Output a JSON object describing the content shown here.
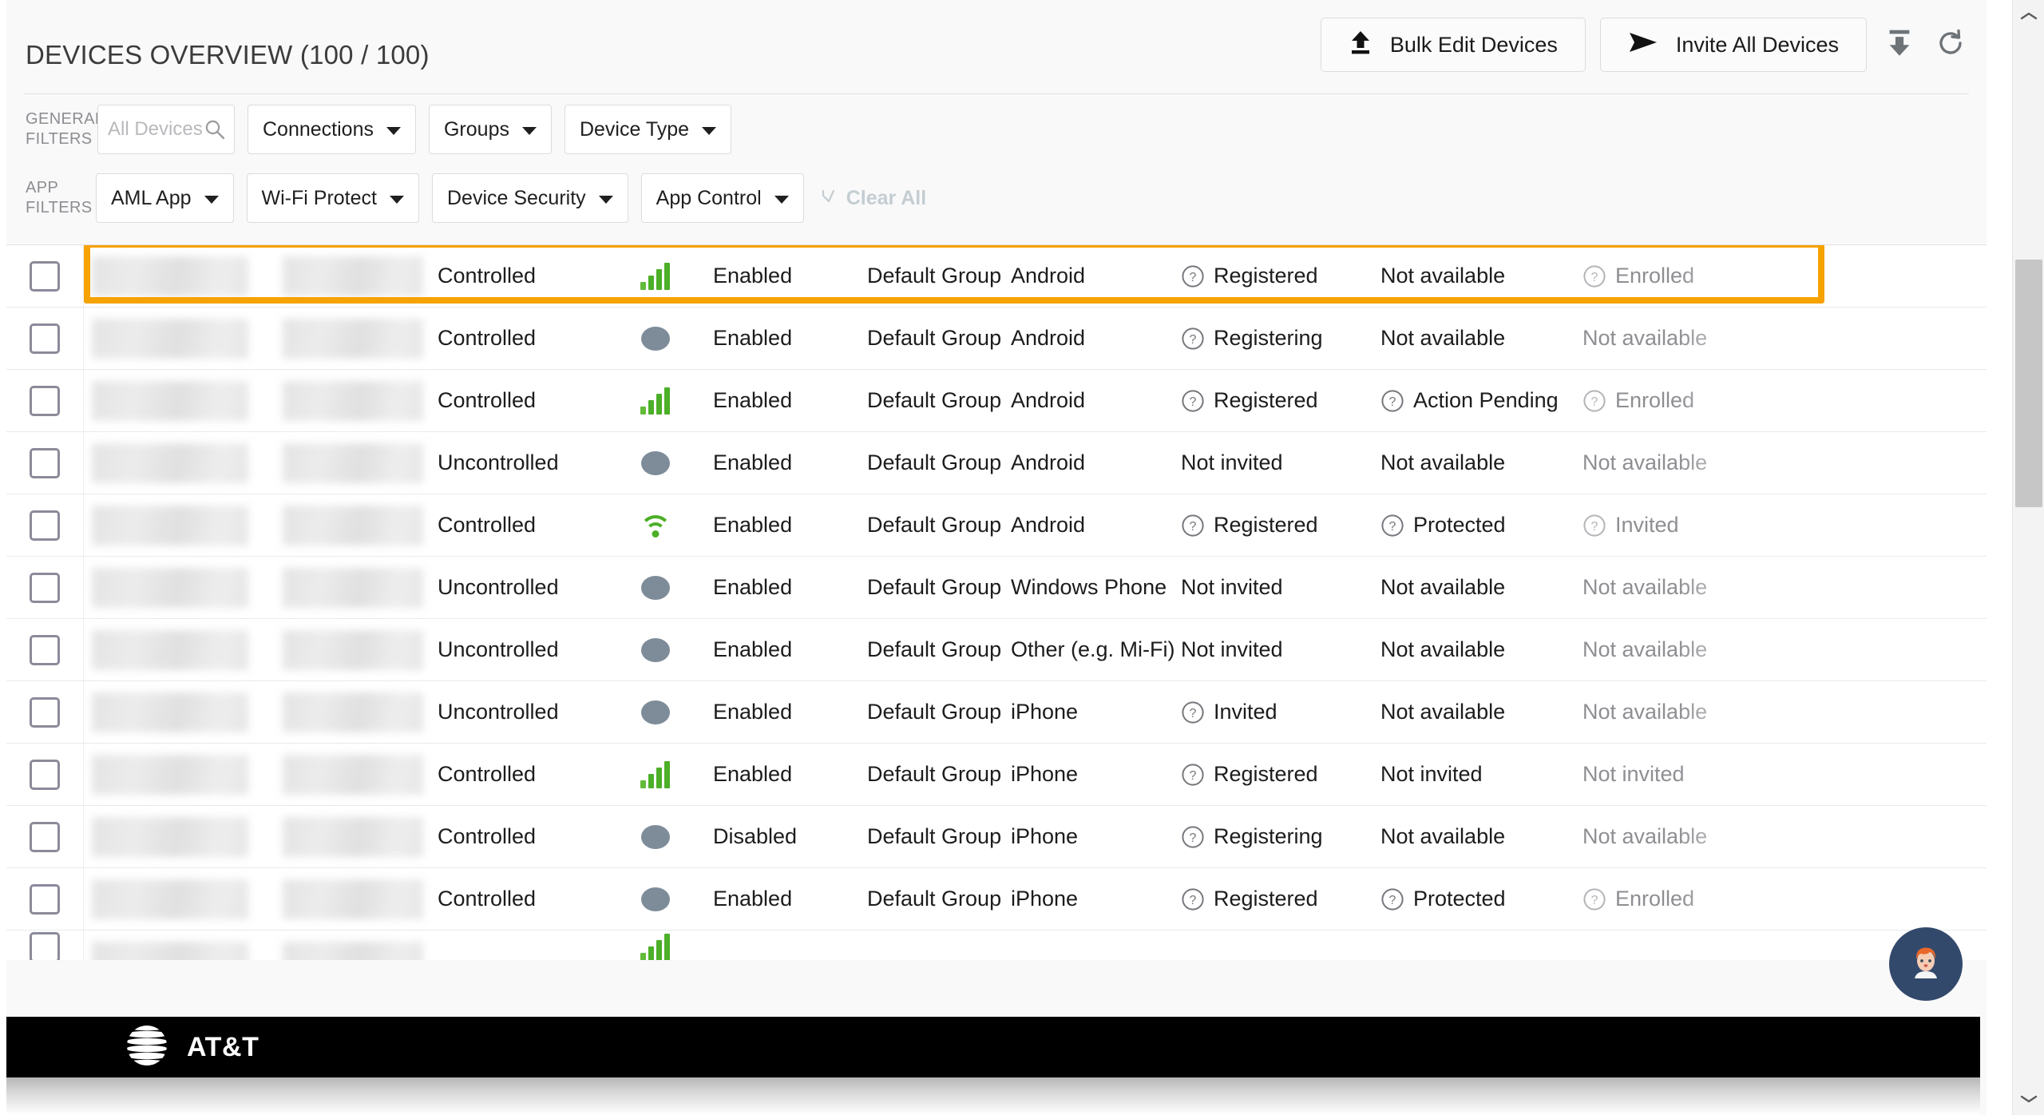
{
  "header": {
    "title": "DEVICES OVERVIEW (100 / 100)",
    "bulk_edit_label": "Bulk Edit Devices",
    "invite_all_label": "Invite All Devices"
  },
  "filters": {
    "general_label_line1": "GENERAL",
    "general_label_line2": "FILTERS",
    "app_label_line1": "APP",
    "app_label_line2": "FILTERS",
    "search_placeholder": "All Devices",
    "search_value": "",
    "general_dropdowns": [
      "Connections",
      "Groups",
      "Device Type"
    ],
    "app_dropdowns": [
      "AML App",
      "Wi-Fi Protect",
      "Device Security",
      "App Control"
    ],
    "clear_all_label": "Clear All"
  },
  "table": {
    "rows": [
      {
        "controlled": "Controlled",
        "conn": "signal",
        "app_control": "Enabled",
        "group": "Default Group",
        "type": "Android",
        "registration": "Registered",
        "registration_icon": true,
        "protection": "Not available",
        "protection_icon": false,
        "enrollment": "Enrolled",
        "enrollment_icon": true,
        "highlighted": true
      },
      {
        "controlled": "Controlled",
        "conn": "off",
        "app_control": "Enabled",
        "group": "Default Group",
        "type": "Android",
        "registration": "Registering",
        "registration_icon": true,
        "protection": "Not available",
        "protection_icon": false,
        "enrollment": "Not available",
        "enrollment_icon": false,
        "highlighted": false
      },
      {
        "controlled": "Controlled",
        "conn": "signal",
        "app_control": "Enabled",
        "group": "Default Group",
        "type": "Android",
        "registration": "Registered",
        "registration_icon": true,
        "protection": "Action Pending",
        "protection_icon": true,
        "enrollment": "Enrolled",
        "enrollment_icon": true,
        "highlighted": false
      },
      {
        "controlled": "Uncontrolled",
        "conn": "off",
        "app_control": "Enabled",
        "group": "Default Group",
        "type": "Android",
        "registration": "Not invited",
        "registration_icon": false,
        "protection": "Not available",
        "protection_icon": false,
        "enrollment": "Not available",
        "enrollment_icon": false,
        "highlighted": false
      },
      {
        "controlled": "Controlled",
        "conn": "wifi",
        "app_control": "Enabled",
        "group": "Default Group",
        "type": "Android",
        "registration": "Registered",
        "registration_icon": true,
        "protection": "Protected",
        "protection_icon": true,
        "enrollment": "Invited",
        "enrollment_icon": true,
        "highlighted": false
      },
      {
        "controlled": "Uncontrolled",
        "conn": "off",
        "app_control": "Enabled",
        "group": "Default Group",
        "type": "Windows Phone",
        "registration": "Not invited",
        "registration_icon": false,
        "protection": "Not available",
        "protection_icon": false,
        "enrollment": "Not available",
        "enrollment_icon": false,
        "highlighted": false
      },
      {
        "controlled": "Uncontrolled",
        "conn": "off",
        "app_control": "Enabled",
        "group": "Default Group",
        "type": "Other (e.g. Mi-Fi)",
        "registration": "Not invited",
        "registration_icon": false,
        "protection": "Not available",
        "protection_icon": false,
        "enrollment": "Not available",
        "enrollment_icon": false,
        "highlighted": false
      },
      {
        "controlled": "Uncontrolled",
        "conn": "off",
        "app_control": "Enabled",
        "group": "Default Group",
        "type": "iPhone",
        "registration": "Invited",
        "registration_icon": true,
        "protection": "Not available",
        "protection_icon": false,
        "enrollment": "Not available",
        "enrollment_icon": false,
        "highlighted": false
      },
      {
        "controlled": "Controlled",
        "conn": "signal",
        "app_control": "Enabled",
        "group": "Default Group",
        "type": "iPhone",
        "registration": "Registered",
        "registration_icon": true,
        "protection": "Not invited",
        "protection_icon": false,
        "enrollment": "Not invited",
        "enrollment_icon": false,
        "highlighted": false
      },
      {
        "controlled": "Controlled",
        "conn": "off",
        "app_control": "Disabled",
        "group": "Default Group",
        "type": "iPhone",
        "registration": "Registering",
        "registration_icon": true,
        "protection": "Not available",
        "protection_icon": false,
        "enrollment": "Not available",
        "enrollment_icon": false,
        "highlighted": false
      },
      {
        "controlled": "Controlled",
        "conn": "off",
        "app_control": "Enabled",
        "group": "Default Group",
        "type": "iPhone",
        "registration": "Registered",
        "registration_icon": true,
        "protection": "Protected",
        "protection_icon": true,
        "enrollment": "Enrolled",
        "enrollment_icon": true,
        "highlighted": false
      }
    ]
  },
  "footer": {
    "brand": "AT&T"
  },
  "colors": {
    "highlight": "#f6a200",
    "connected": "#4caf28",
    "offline": "#7e8c9a",
    "chat_bubble": "#33496b"
  }
}
